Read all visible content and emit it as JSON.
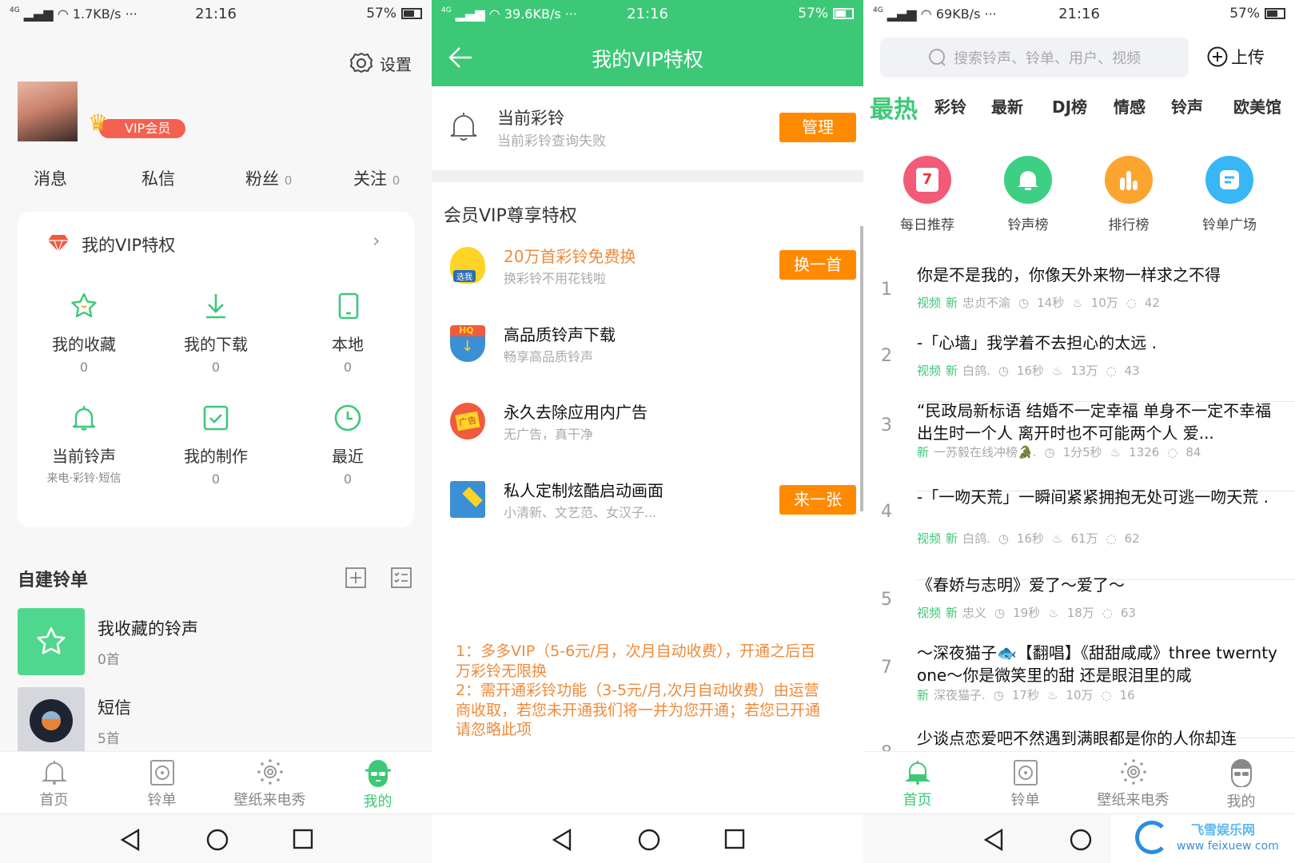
{
  "colors": {
    "accent": "#3dc878",
    "orange": "#ff8a00",
    "vip_badge": "#f4604f"
  },
  "left": {
    "status": {
      "network": "4G",
      "speed": "1.7KB/s",
      "more": "···",
      "time": "21:16",
      "battery": "57%"
    },
    "settings_label": "设置",
    "vip_badge": "VIP会员",
    "stats": [
      {
        "label": "消息",
        "count": ""
      },
      {
        "label": "私信",
        "count": ""
      },
      {
        "label": "粉丝",
        "count": "0"
      },
      {
        "label": "关注",
        "count": "0"
      }
    ],
    "vip_card": {
      "title": "我的VIP特权",
      "items": [
        {
          "label": "我的收藏",
          "sub": "0",
          "icon": "star-icon"
        },
        {
          "label": "我的下载",
          "sub": "0",
          "icon": "download-icon"
        },
        {
          "label": "本地",
          "sub": "0",
          "icon": "phone-icon"
        },
        {
          "label": "当前铃声",
          "sub": "来电·彩铃·短信",
          "icon": "bell-icon"
        },
        {
          "label": "我的制作",
          "sub": "0",
          "icon": "check-square-icon"
        },
        {
          "label": "最近",
          "sub": "0",
          "icon": "clock-icon"
        }
      ]
    },
    "playlists": {
      "title": "自建铃单",
      "items": [
        {
          "title": "我收藏的铃声",
          "count": "0首"
        },
        {
          "title": "短信",
          "count": "5首"
        }
      ]
    },
    "tabs": [
      {
        "label": "首页",
        "icon": "bell-icon"
      },
      {
        "label": "铃单",
        "icon": "disc-icon"
      },
      {
        "label": "壁纸来电秀",
        "icon": "wallpaper-icon"
      },
      {
        "label": "我的",
        "icon": "profile-icon",
        "active": true
      }
    ]
  },
  "middle": {
    "status": {
      "network": "4G",
      "speed": "39.6KB/s",
      "more": "···",
      "time": "21:16",
      "battery": "57%"
    },
    "title": "我的VIP特权",
    "current": {
      "title": "当前彩铃",
      "sub": "当前彩铃查询失败",
      "button": "管理"
    },
    "section_title": "会员VIP尊享特权",
    "privileges": [
      {
        "title": "20万首彩铃免费换",
        "sub": "换彩铃不用花钱啦",
        "button": "换一首",
        "icon_text": "选我"
      },
      {
        "title": "高品质铃声下载",
        "sub": "畅享高品质铃声",
        "button": "",
        "icon_text": "HQ"
      },
      {
        "title": "永久去除应用内广告",
        "sub": "无广告，真干净",
        "button": "",
        "icon_text": "广告"
      },
      {
        "title": "私人定制炫酷启动画面",
        "sub": "小清新、文艺范、女汉子...",
        "button": "来一张",
        "icon_text": ""
      }
    ],
    "notes": [
      "1：多多VIP（5-6元/月，次月自动收费），开通之后百万彩铃无限换",
      "2：需开通彩铃功能（3-5元/月,次月自动收费）由运营商收取，若您未开通我们将一并为您开通；若您已开通请忽略此项"
    ]
  },
  "right": {
    "status": {
      "network": "4G",
      "speed": "69KB/s",
      "more": "···",
      "time": "21:16",
      "battery": "57%"
    },
    "search_placeholder": "搜索铃声、铃单、用户、视频",
    "upload": "上传",
    "categories": [
      "最热",
      "彩铃",
      "最新",
      "DJ榜",
      "情感",
      "铃声",
      "欧美馆"
    ],
    "quick": [
      {
        "label": "每日推荐",
        "icon_text": "7",
        "color": "#f25a78"
      },
      {
        "label": "铃声榜",
        "color": "#3dcf83"
      },
      {
        "label": "排行榜",
        "color": "#fba531"
      },
      {
        "label": "铃单广场",
        "color": "#38b6f5"
      }
    ],
    "songs": [
      {
        "num": "1",
        "title": "你是不是我的，你像天外来物一样求之不得",
        "tags": [
          "视频",
          "新"
        ],
        "author": "忠贞不渝",
        "duration": "14秒",
        "likes": "10万",
        "comments": "42"
      },
      {
        "num": "2",
        "title": "-「心墙」我学着不去担心的太远 .",
        "tags": [
          "视频",
          "新"
        ],
        "author": "白鸽.",
        "duration": "16秒",
        "likes": "13万",
        "comments": "43"
      },
      {
        "num": "3",
        "title": "“民政局新标语 结婚不一定幸福 单身不一定不幸福 出生时一个人 离开时也不可能两个人 爱...",
        "tags": [
          "新"
        ],
        "author": "一苏毅在线冲榜🐊.",
        "duration": "1分5秒",
        "likes": "1326",
        "comments": "84"
      },
      {
        "num": "4",
        "title": "-「一吻天荒」一瞬间紧紧拥抱无处可逃一吻天荒 .",
        "tags": [
          "视频",
          "新"
        ],
        "author": "白鸽.",
        "duration": "16秒",
        "likes": "61万",
        "comments": "62"
      },
      {
        "num": "5",
        "title": "《春娇与志明》爱了～爱了～",
        "tags": [
          "视频",
          "新"
        ],
        "author": "忠义",
        "duration": "19秒",
        "likes": "18万",
        "comments": "63"
      },
      {
        "num": "7",
        "title": "～深夜猫子🐟【翻唱】《甜甜咸咸》three twernty one～你是微笑里的甜 还是眼泪里的咸",
        "tags": [
          "新"
        ],
        "author": "深夜猫子.",
        "duration": "17秒",
        "likes": "10万",
        "comments": "16"
      },
      {
        "num": "8",
        "title": "少谈点恋爱吧不然遇到满眼都是你的人你却连",
        "tags": [],
        "author": "",
        "duration": "",
        "likes": "",
        "comments": ""
      }
    ],
    "tabs": [
      {
        "label": "首页",
        "icon": "bell-icon",
        "active": true
      },
      {
        "label": "铃单",
        "icon": "disc-icon"
      },
      {
        "label": "壁纸来电秀",
        "icon": "wallpaper-icon"
      },
      {
        "label": "我的",
        "icon": "profile-icon"
      }
    ],
    "watermark": {
      "name": "飞雪娱乐网",
      "url": "www feixuew com"
    }
  }
}
